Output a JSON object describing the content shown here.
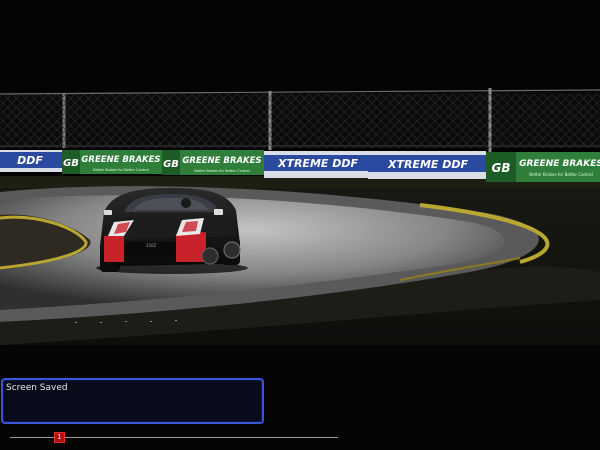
{
  "hud": {
    "message": "Screen Saved",
    "replay_marker_label": "1",
    "replay_progress": 0.15
  },
  "banners": {
    "greene_brakes": "GREENE BRAKES",
    "greene_tagline": "Better Brakes for Better Control",
    "greene_logo": "GB",
    "xtreme_ddf": "XTREME DDF",
    "ddf_short": "DDF"
  },
  "car": {
    "badge": "350Z"
  },
  "colors": {
    "message_border": "#3a55d8",
    "replay_marker": "#b01010",
    "banner_green": "#2f7f3a",
    "banner_blue": "#2a4aa0"
  }
}
